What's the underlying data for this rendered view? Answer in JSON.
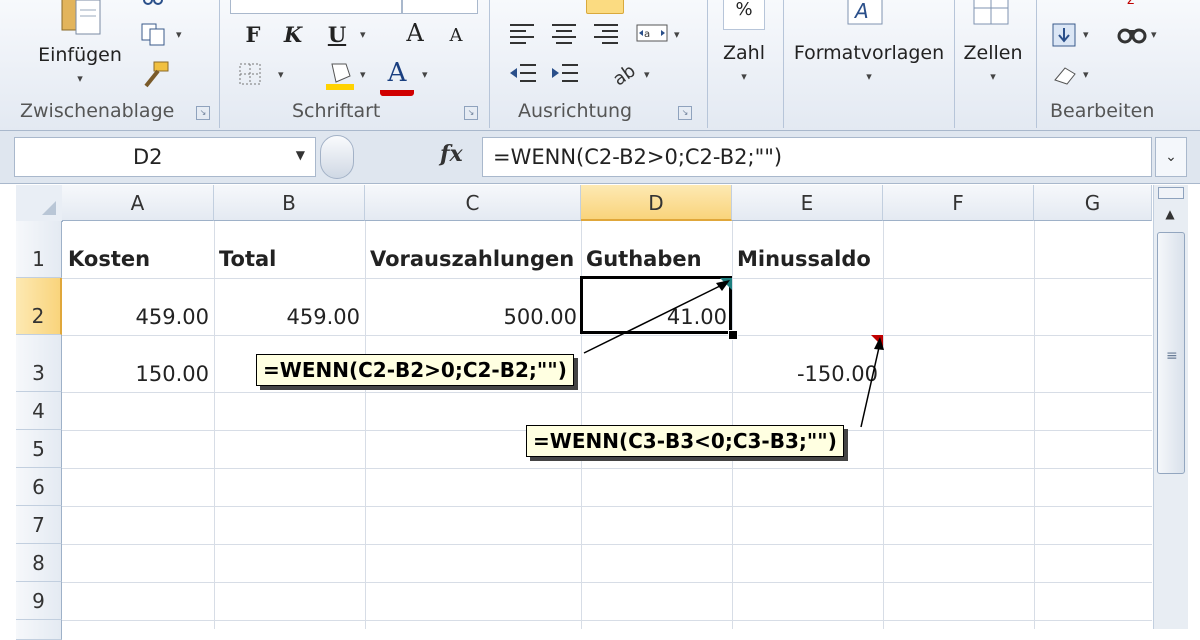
{
  "ribbon": {
    "clipboard": {
      "paste_label": "Einfügen",
      "group_label": "Zwischenablage"
    },
    "font": {
      "bold": "F",
      "italic": "K",
      "underline": "U",
      "grow": "A",
      "shrink": "A",
      "color_letter": "A",
      "group_label": "Schriftart"
    },
    "alignment": {
      "group_label": "Ausrichtung"
    },
    "number": {
      "label": "Zahl",
      "icon_text": "%"
    },
    "styles": {
      "label": "Formatvorlagen"
    },
    "cells": {
      "label": "Zellen"
    },
    "editing": {
      "group_label": "Bearbeiten"
    }
  },
  "formula_bar": {
    "name_box": "D2",
    "fx_label": "fx",
    "formula": "=WENN(C2-B2>0;C2-B2;\"\")"
  },
  "grid": {
    "columns": [
      "A",
      "B",
      "C",
      "D",
      "E",
      "F",
      "G"
    ],
    "rows": [
      "1",
      "2",
      "3",
      "4",
      "5",
      "6",
      "7",
      "8",
      "9"
    ],
    "cells": {
      "A1": "Kosten",
      "B1": "Total",
      "C1": "Vorauszahlungen",
      "D1": "Guthaben",
      "E1": "Minussaldo",
      "A2": "459.00",
      "B2": "459.00",
      "C2": "500.00",
      "D2": "41.00",
      "A3": "150.00",
      "E3": "-150.00"
    }
  },
  "callouts": {
    "c1": "=WENN(C2-B2>0;C2-B2;\"\")",
    "c2": "=WENN(C3-B3<0;C3-B3;\"\")"
  },
  "colors": {
    "selection_header": "#f9d47c",
    "callout_bg": "#ffffe1",
    "font_red": "#d00000",
    "highlight_yellow": "#ffd200"
  }
}
